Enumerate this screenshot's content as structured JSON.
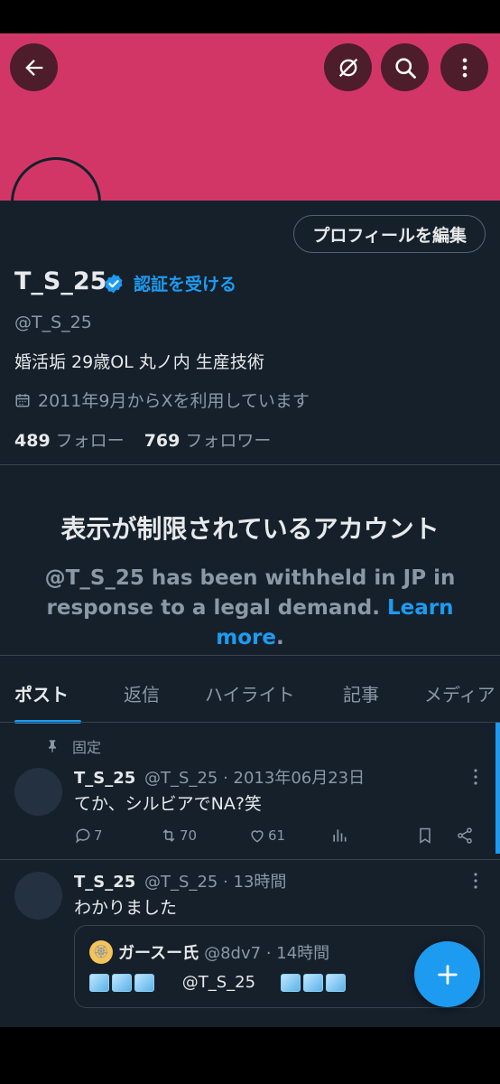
{
  "colors": {
    "banner": "#d23667",
    "background": "#15202b",
    "accent": "#1d9bf0",
    "muted": "#8b98a5"
  },
  "header": {
    "back_icon": "arrow-left-icon",
    "translate_icon": "translate-off-icon",
    "search_icon": "search-icon",
    "more_icon": "more-vertical-icon"
  },
  "profile": {
    "edit_label": "プロフィールを編集",
    "display_name": "T_S_25",
    "get_verified": "認証を受ける",
    "handle": "@T_S_25",
    "bio": "婚活垢 29歳OL 丸ノ内 生産技術",
    "joined": "2011年9月からXを利用しています",
    "following_count": "489",
    "following_label": "フォロー",
    "followers_count": "769",
    "followers_label": "フォロワー"
  },
  "withheld": {
    "title": "表示が制限されているアカウント",
    "message": "@T_S_25 has been withheld in JP in response to a legal demand.",
    "link": "Learn more"
  },
  "tabs": [
    "ポスト",
    "返信",
    "ハイライト",
    "記事",
    "メディア"
  ],
  "pinned_label": "固定",
  "tweets": [
    {
      "name": "T_S_25",
      "handle_time": "@T_S_25 · 2013年06月23日",
      "text": "てか、シルビアでNA?笑",
      "replies": "7",
      "retweets": "70",
      "likes": "61"
    },
    {
      "name": "T_S_25",
      "handle_time": "@T_S_25 · 13時間",
      "text": "わかりました",
      "quote": {
        "name": "ガースー氏",
        "handle_time": "@8dv7 · 14時間",
        "mention": "@T_S_25"
      }
    }
  ]
}
